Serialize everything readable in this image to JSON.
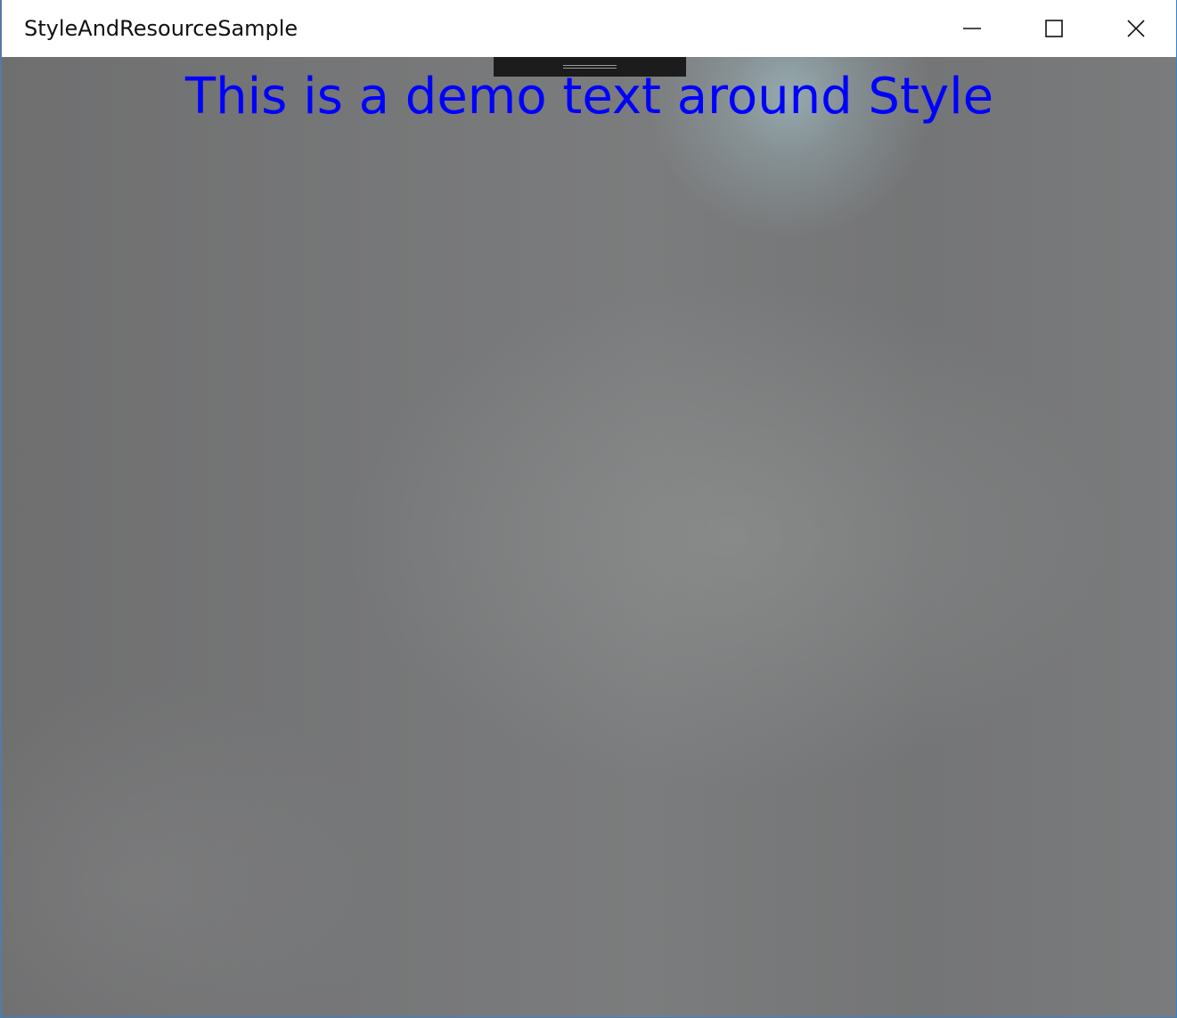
{
  "window": {
    "title": "StyleAndResourceSample",
    "controls": {
      "minimize": "minimize-icon",
      "maximize": "maximize-icon",
      "close": "close-icon"
    }
  },
  "content": {
    "demo_text": "This is a demo text around Style"
  },
  "colors": {
    "title_bar": "#ffffff",
    "window_border": "#2f83d6",
    "demo_text": "#0000ff",
    "background": "#747576",
    "debug_toolbar": "#1c1c1c"
  }
}
